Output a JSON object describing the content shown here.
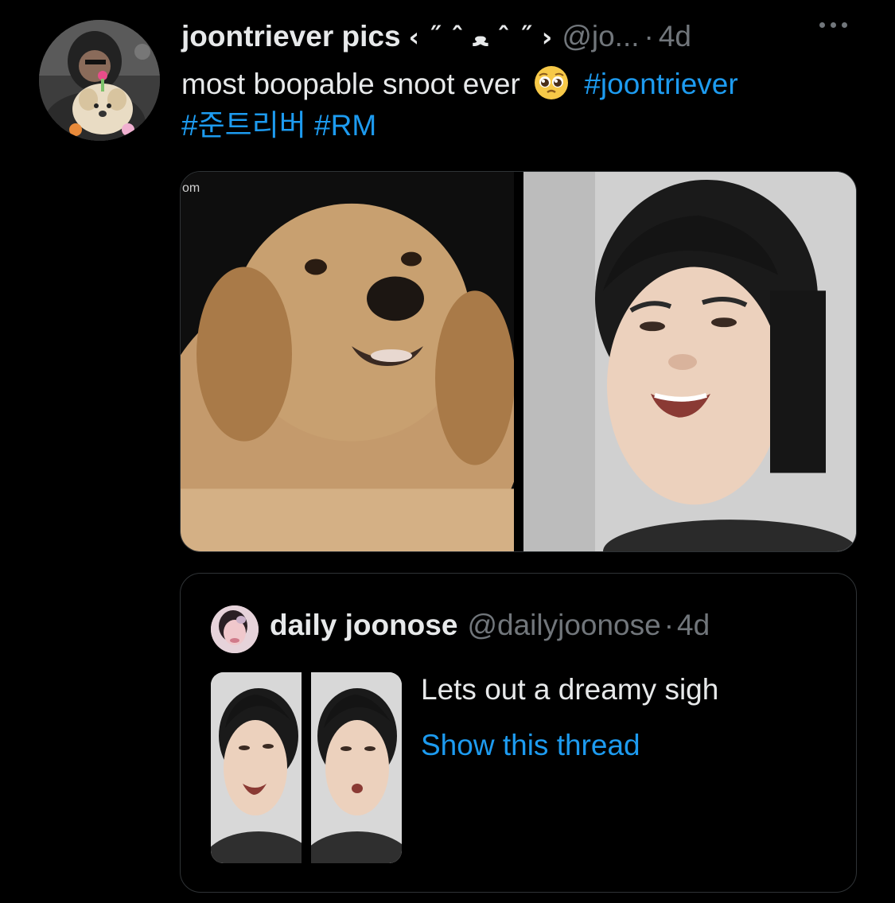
{
  "tweet": {
    "author_name": "joontriever pics",
    "author_decoration": "‹ ˝ ˆ ﻌ ˆ ˝ ›",
    "author_handle": "@jo...",
    "separator": "·",
    "time": "4d",
    "text": "most boopable snoot ever",
    "emoji": "pleading-face-emoji",
    "hashtags": [
      "#joontriever",
      "#준트리버",
      "#RM"
    ],
    "image_watermark": "om"
  },
  "quoted": {
    "author_name": "daily joonose",
    "author_handle": "@dailyjoonose",
    "separator": "·",
    "time": "4d",
    "text": "Lets out a dreamy sigh",
    "show_thread": "Show this thread"
  },
  "colors": {
    "background": "#000000",
    "text": "#e7e9ea",
    "muted": "#71767b",
    "accent": "#1d9bf0",
    "border": "#2f3336"
  }
}
